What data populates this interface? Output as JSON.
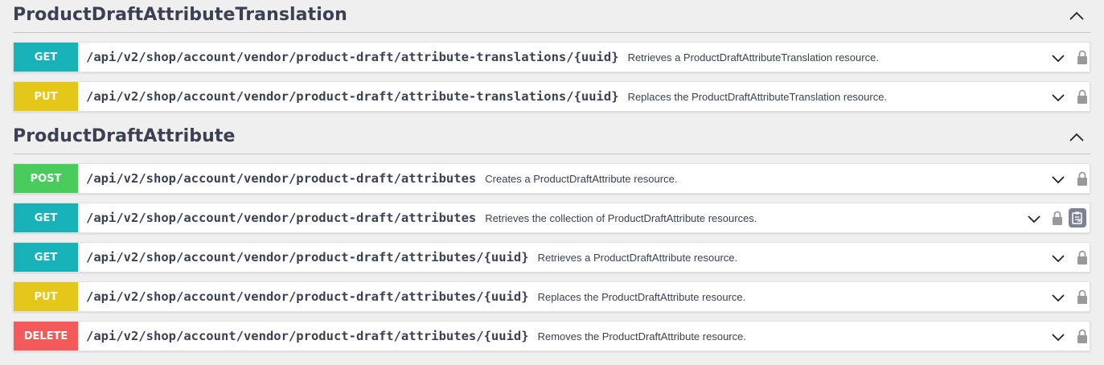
{
  "sections": [
    {
      "title": "ProductDraftAttributeTranslation",
      "operations": [
        {
          "method": "GET",
          "color": "#17b1b8",
          "path": "/api/v2/shop/account/vendor/product-draft/attribute-translations/{uuid}",
          "summary": "Retrieves a ProductDraftAttributeTranslation resource."
        },
        {
          "method": "PUT",
          "color": "#e5c71a",
          "path": "/api/v2/shop/account/vendor/product-draft/attribute-translations/{uuid}",
          "summary": "Replaces the ProductDraftAttributeTranslation resource."
        }
      ]
    },
    {
      "title": "ProductDraftAttribute",
      "operations": [
        {
          "method": "POST",
          "color": "#49cc5c",
          "path": "/api/v2/shop/account/vendor/product-draft/attributes",
          "summary": "Creates a ProductDraftAttribute resource."
        },
        {
          "method": "GET",
          "color": "#17b1b8",
          "path": "/api/v2/shop/account/vendor/product-draft/attributes",
          "summary": "Retrieves the collection of ProductDraftAttribute resources."
        },
        {
          "method": "GET",
          "color": "#17b1b8",
          "path": "/api/v2/shop/account/vendor/product-draft/attributes/{uuid}",
          "summary": "Retrieves a ProductDraftAttribute resource."
        },
        {
          "method": "PUT",
          "color": "#e5c71a",
          "path": "/api/v2/shop/account/vendor/product-draft/attributes/{uuid}",
          "summary": "Replaces the ProductDraftAttribute resource."
        },
        {
          "method": "DELETE",
          "color": "#f35b5b",
          "path": "/api/v2/shop/account/vendor/product-draft/attributes/{uuid}",
          "summary": "Removes the ProductDraftAttribute resource."
        }
      ]
    }
  ],
  "icons": {
    "section_toggle": "chevron-up-icon",
    "op_toggle": "chevron-down-icon",
    "lock": "lock-icon",
    "copy": "clipboard-copy-icon"
  }
}
